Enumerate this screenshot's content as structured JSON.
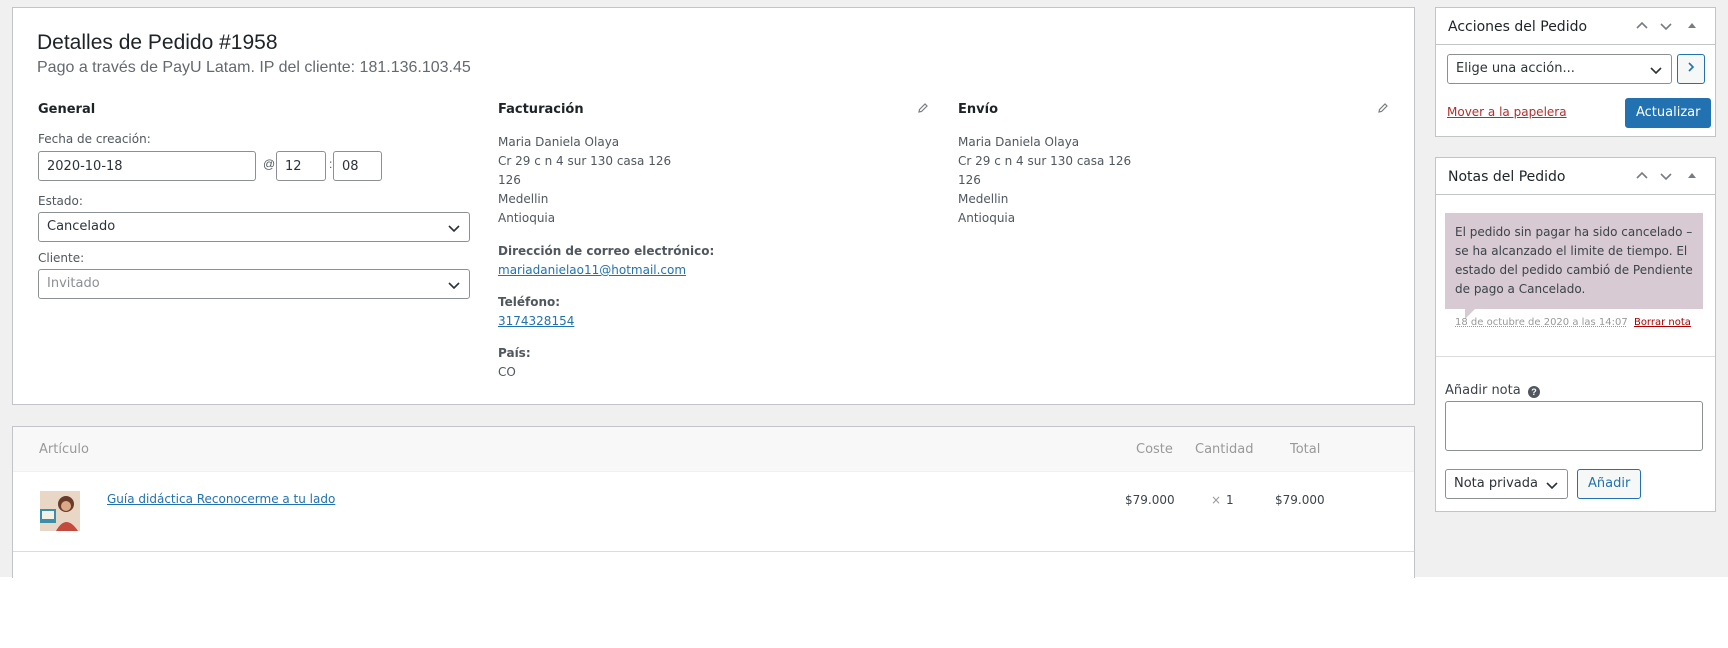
{
  "order": {
    "title": "Detalles de Pedido #1958",
    "subtitle": "Pago a través de PayU Latam. IP del cliente: 181.136.103.45"
  },
  "general": {
    "heading": "General",
    "date_label": "Fecha de creación:",
    "date_value": "2020-10-18",
    "at_sep": "@",
    "hour": "12",
    "colon": ":",
    "minute": "08",
    "status_label": "Estado:",
    "status_value": "Cancelado",
    "customer_label": "Cliente:",
    "customer_value": "Invitado"
  },
  "billing": {
    "heading": "Facturación",
    "address_lines": [
      "Maria Daniela Olaya",
      "Cr 29 c n 4 sur 130 casa 126",
      "126",
      "Medellin",
      "Antioquia"
    ],
    "email_label": "Dirección de correo electrónico:",
    "email": "mariadanielao11@hotmail.com",
    "phone_label": "Teléfono:",
    "phone": "3174328154",
    "country_label": "País:",
    "country": "CO"
  },
  "shipping": {
    "heading": "Envío",
    "address_lines": [
      "Maria Daniela Olaya",
      "Cr 29 c n 4 sur 130 casa 126",
      "126",
      "Medellin",
      "Antioquia"
    ]
  },
  "items": {
    "headers": {
      "item": "Artículo",
      "cost": "Coste",
      "qty": "Cantidad",
      "total": "Total"
    },
    "rows": [
      {
        "name": "Guía didáctica Reconocerme a tu lado",
        "cost": "$79.000",
        "qty_x": "×",
        "qty": "1",
        "total": "$79.000"
      }
    ]
  },
  "actions_box": {
    "title": "Acciones del Pedido",
    "select_value": "Elige una acción...",
    "trash_link": "Mover a la papelera",
    "update_button": "Actualizar"
  },
  "notes_box": {
    "title": "Notas del Pedido",
    "note_text": "El pedido sin pagar ha sido cancelado – se ha alcanzado el limite de tiempo. El estado del pedido cambió de Pendiente de pago a Cancelado.",
    "note_meta": "18 de octubre de 2020 a las 14:07",
    "delete_link": "Borrar nota",
    "add_label": "Añadir nota",
    "help_glyph": "?",
    "note_type": "Nota privada",
    "add_button": "Añadir"
  },
  "colors": {
    "primary": "#2271b1",
    "danger": "#b32d2e",
    "note_bg": "#d7cad2"
  }
}
